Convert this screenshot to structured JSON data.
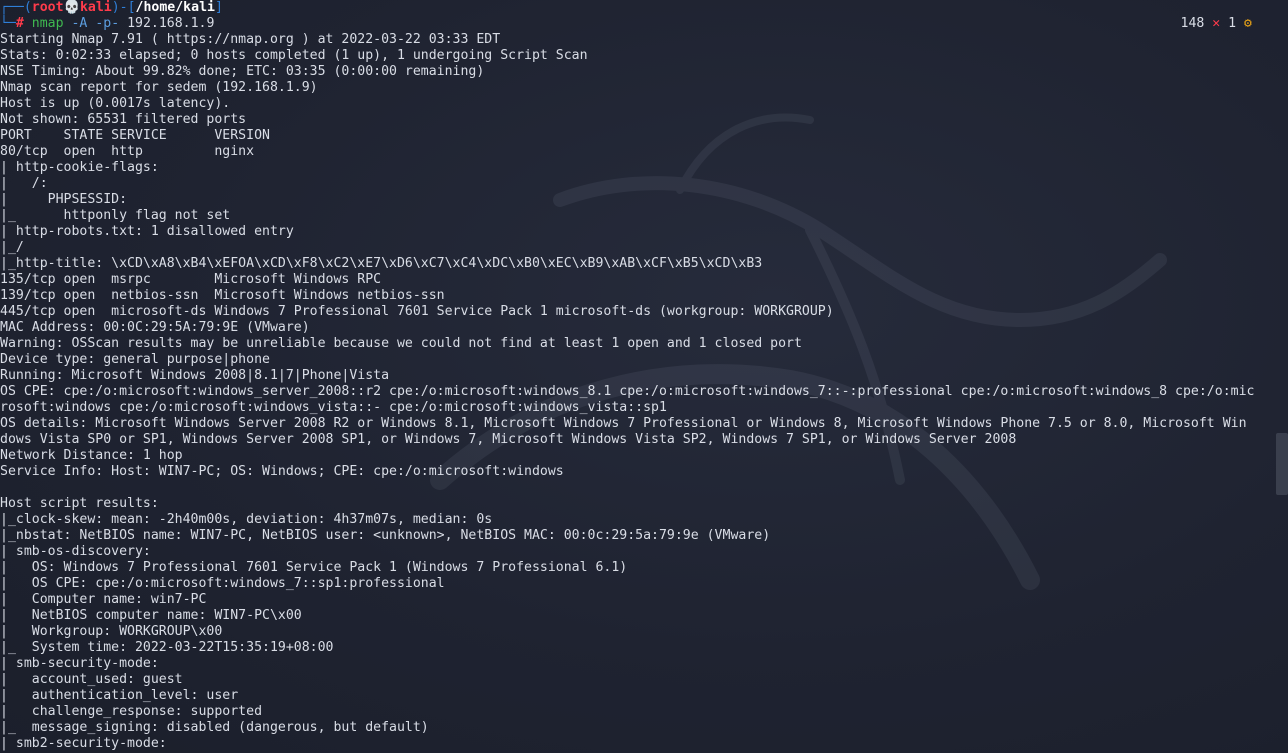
{
  "prompt": {
    "frame_top": "┌──(",
    "user": "root",
    "skull": "💀",
    "host": "kali",
    "frame_mid": ")-[",
    "path": "/home/kali",
    "frame_end": "]",
    "frame_bottom": "└─",
    "hash": "# ",
    "cmd": "nmap",
    "flag1": " -A",
    "flag2": " -p-",
    "arg": " 192.168.1.9"
  },
  "status": {
    "count": "148",
    "x_icon": " ✕",
    "errors": " 1",
    "gear_icon": " ⚙"
  },
  "output_lines": [
    "Starting Nmap 7.91 ( https://nmap.org ) at 2022-03-22 03:33 EDT",
    "Stats: 0:02:33 elapsed; 0 hosts completed (1 up), 1 undergoing Script Scan",
    "NSE Timing: About 99.82% done; ETC: 03:35 (0:00:00 remaining)",
    "Nmap scan report for sedem (192.168.1.9)",
    "Host is up (0.0017s latency).",
    "Not shown: 65531 filtered ports",
    "PORT    STATE SERVICE      VERSION",
    "80/tcp  open  http         nginx",
    "| http-cookie-flags:",
    "|   /:",
    "|     PHPSESSID:",
    "|_      httponly flag not set",
    "| http-robots.txt: 1 disallowed entry",
    "|_/",
    "|_http-title: \\xCD\\xA8\\xB4\\xEFOA\\xCD\\xF8\\xC2\\xE7\\xD6\\xC7\\xC4\\xDC\\xB0\\xEC\\xB9\\xAB\\xCF\\xB5\\xCD\\xB3",
    "135/tcp open  msrpc        Microsoft Windows RPC",
    "139/tcp open  netbios-ssn  Microsoft Windows netbios-ssn",
    "445/tcp open  microsoft-ds Windows 7 Professional 7601 Service Pack 1 microsoft-ds (workgroup: WORKGROUP)",
    "MAC Address: 00:0C:29:5A:79:9E (VMware)",
    "Warning: OSScan results may be unreliable because we could not find at least 1 open and 1 closed port",
    "Device type: general purpose|phone",
    "Running: Microsoft Windows 2008|8.1|7|Phone|Vista",
    "OS CPE: cpe:/o:microsoft:windows_server_2008::r2 cpe:/o:microsoft:windows_8.1 cpe:/o:microsoft:windows_7::-:professional cpe:/o:microsoft:windows_8 cpe:/o:mic",
    "rosoft:windows cpe:/o:microsoft:windows_vista::- cpe:/o:microsoft:windows_vista::sp1",
    "OS details: Microsoft Windows Server 2008 R2 or Windows 8.1, Microsoft Windows 7 Professional or Windows 8, Microsoft Windows Phone 7.5 or 8.0, Microsoft Win",
    "dows Vista SP0 or SP1, Windows Server 2008 SP1, or Windows 7, Microsoft Windows Vista SP2, Windows 7 SP1, or Windows Server 2008",
    "Network Distance: 1 hop",
    "Service Info: Host: WIN7-PC; OS: Windows; CPE: cpe:/o:microsoft:windows",
    "",
    "Host script results:",
    "|_clock-skew: mean: -2h40m00s, deviation: 4h37m07s, median: 0s",
    "|_nbstat: NetBIOS name: WIN7-PC, NetBIOS user: <unknown>, NetBIOS MAC: 00:0c:29:5a:79:9e (VMware)",
    "| smb-os-discovery:",
    "|   OS: Windows 7 Professional 7601 Service Pack 1 (Windows 7 Professional 6.1)",
    "|   OS CPE: cpe:/o:microsoft:windows_7::sp1:professional",
    "|   Computer name: win7-PC",
    "|   NetBIOS computer name: WIN7-PC\\x00",
    "|   Workgroup: WORKGROUP\\x00",
    "|_  System time: 2022-03-22T15:35:19+08:00",
    "| smb-security-mode:",
    "|   account_used: guest",
    "|   authentication_level: user",
    "|   challenge_response: supported",
    "|_  message_signing: disabled (dangerous, but default)",
    "| smb2-security-mode:"
  ]
}
